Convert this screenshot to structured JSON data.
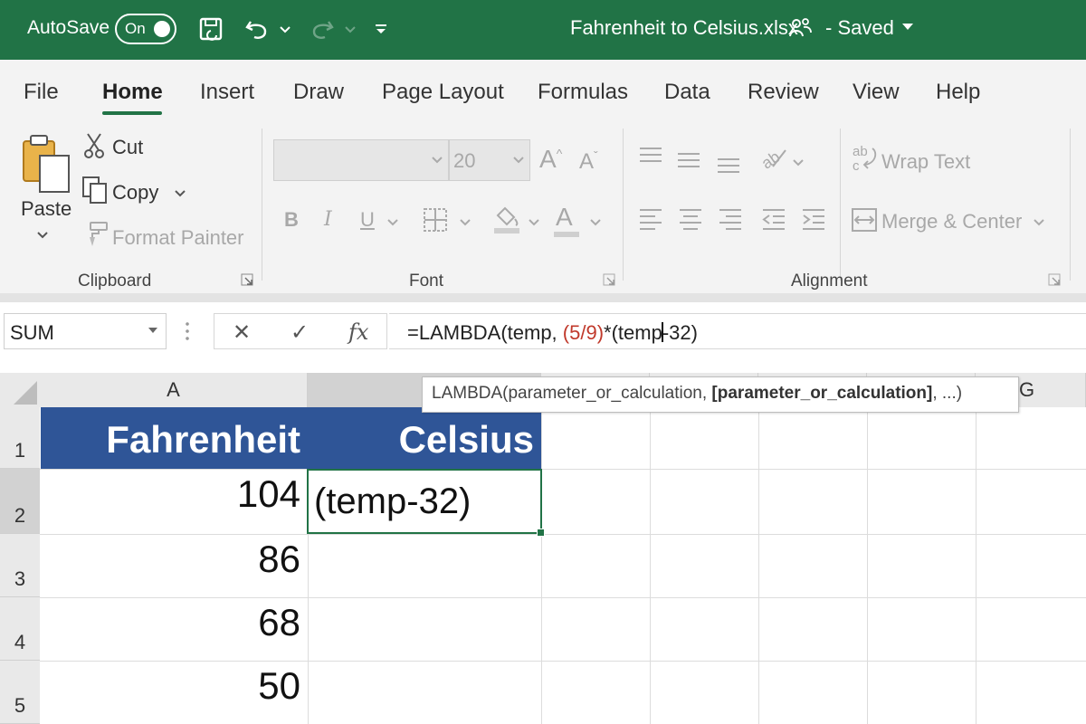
{
  "titlebar": {
    "autosave_label": "AutoSave",
    "autosave_state": "On",
    "file_title": "Fahrenheit to Celsius.xlsx",
    "saved_label": "- Saved",
    "accent": "#217346"
  },
  "tabs": [
    {
      "label": "File"
    },
    {
      "label": "Home"
    },
    {
      "label": "Insert"
    },
    {
      "label": "Draw"
    },
    {
      "label": "Page Layout"
    },
    {
      "label": "Formulas"
    },
    {
      "label": "Data"
    },
    {
      "label": "Review"
    },
    {
      "label": "View"
    },
    {
      "label": "Help"
    }
  ],
  "active_tab": "Home",
  "ribbon": {
    "clipboard": {
      "paste": "Paste",
      "cut": "Cut",
      "copy": "Copy",
      "format_painter": "Format Painter",
      "group_label": "Clipboard"
    },
    "font": {
      "font_size": "20",
      "bold": "B",
      "italic": "I",
      "underline": "U",
      "font_color_glyph": "A",
      "grow_glyph": "A",
      "shrink_glyph": "A",
      "group_label": "Font"
    },
    "alignment": {
      "wrap_text": "Wrap Text",
      "merge_center": "Merge & Center",
      "group_label": "Alignment"
    }
  },
  "formula_bar": {
    "name_box": "SUM",
    "cancel_glyph": "✕",
    "enter_glyph": "✓",
    "fx_glyph": "fx",
    "formula_prefix": "=LAMBDA(temp, ",
    "formula_paren": "(5/9)",
    "formula_mid": "*(temp",
    "formula_suffix": "-32)"
  },
  "grid": {
    "columns": [
      "A",
      "G"
    ],
    "rows": [
      "1",
      "2",
      "3",
      "4",
      "5"
    ],
    "header_fill": "#2f5597",
    "header_a": "Fahrenheit",
    "header_b": "Celsius",
    "values_a": [
      "104",
      "86",
      "68",
      "50"
    ],
    "active_cell_text": "(temp-32)",
    "tooltip_prefix": "LAMBDA(parameter_or_calculation, ",
    "tooltip_bold": "[parameter_or_calculation]",
    "tooltip_suffix": ", ...)"
  }
}
